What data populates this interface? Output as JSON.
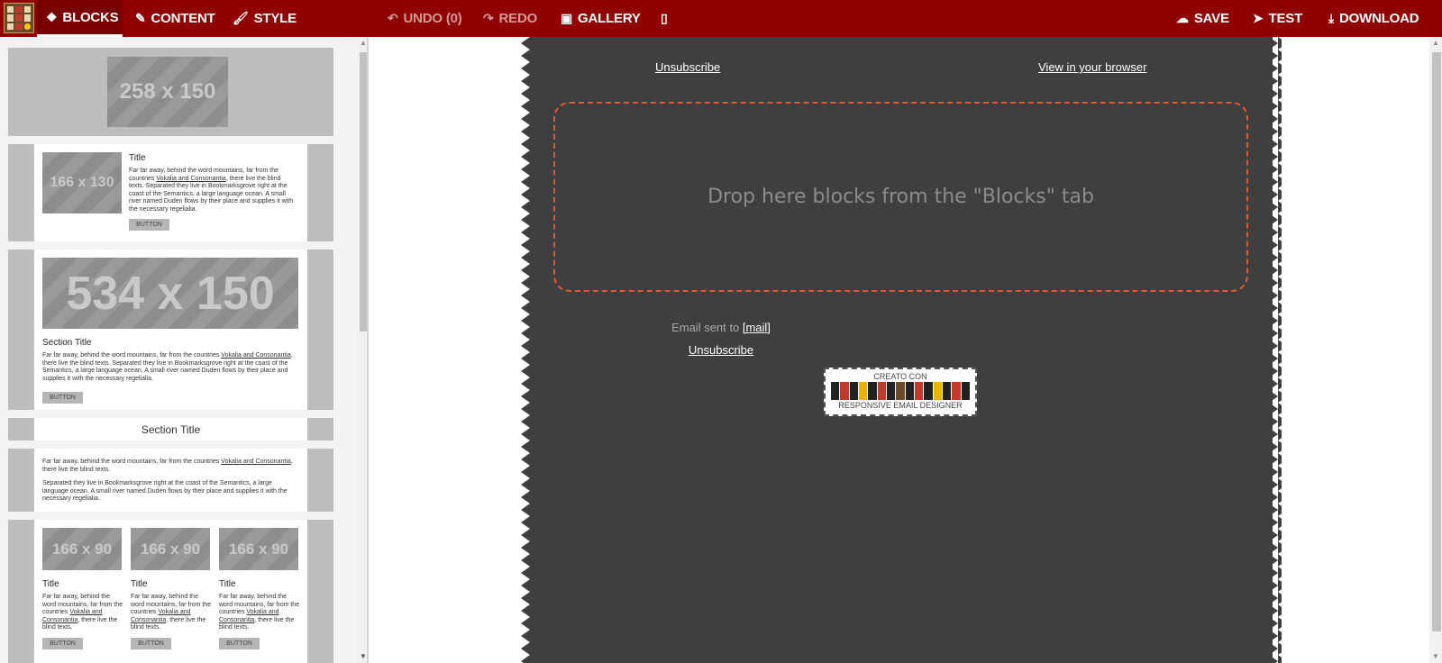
{
  "toolbar": {
    "tabs": [
      {
        "label": "BLOCKS",
        "icon": "cubes-icon"
      },
      {
        "label": "CONTENT",
        "icon": "pencil-icon"
      },
      {
        "label": "STYLE",
        "icon": "brush-icon"
      }
    ],
    "undo_label": "UNDO (0)",
    "redo_label": "REDO",
    "gallery_label": "GALLERY",
    "save_label": "SAVE",
    "test_label": "TEST",
    "download_label": "DOWNLOAD"
  },
  "blocks": {
    "b1": {
      "placeholder": "258 x 150"
    },
    "b2": {
      "placeholder": "166 x 130",
      "title": "Title",
      "text_pre": "Far far away, behind the word mountains, far from the countries ",
      "link": "Vokalia and Consonantia",
      "text_post": ", there live the blind texts. Separated they live in Bookmarksgrove right at the coast of the Semantics, a large language ocean. A small river named Duden flows by their place and supplies it with the necessary regelialia.",
      "button": "BUTTON"
    },
    "b3": {
      "placeholder": "534 x 150",
      "title": "Section Title",
      "text_pre": "Far far away, behind the word mountains, far from the countries ",
      "link": "Vokalia and Consonantia",
      "text_post": ", there live the blind texts. Separated they live in Bookmarksgrove right at the coast of the Semantics, a large language ocean. A small river named Duden flows by their place and supplies it with the necessary regelialia.",
      "button": "BUTTON"
    },
    "b4": {
      "title": "Section Title"
    },
    "b5": {
      "p1_pre": "Far far away, behind the word mountains, far from the countries ",
      "link": "Vokalia and Consonantia",
      "p1_post": ", there live the blind texts.",
      "p2": "Separated they live in Bookmarksgrove right at the coast of the Semantics, a large language ocean. A small river named Duden flows by their place and supplies it with the necessary regelialia."
    },
    "b6": {
      "columns": [
        {
          "placeholder": "166 x 90",
          "title": "Title",
          "text_pre": "Far far away, behind the word mountains, far from the countries ",
          "link": "Vokalia and Consonantia",
          "text_post": ", there live the blind texts.",
          "button": "BUTTON"
        },
        {
          "placeholder": "166 x 90",
          "title": "Title",
          "text_pre": "Far far away, behind the word mountains, far from the countries ",
          "link": "Vokalia and Consonantia",
          "text_post": ", there live the blind texts.",
          "button": "BUTTON"
        },
        {
          "placeholder": "166 x 90",
          "title": "Title",
          "text_pre": "Far far away, behind the word mountains, far from the countries ",
          "link": "Vokalia and Consonantia",
          "text_post": ", there live the blind texts.",
          "button": "BUTTON"
        }
      ]
    }
  },
  "email": {
    "unsubscribe_top": "Unsubscribe",
    "view_browser": "View in your browser",
    "drop_text": "Drop here blocks from the \"Blocks\" tab",
    "sent_to": "Email sent to ",
    "mail_tag": "[mail]",
    "unsubscribe_bottom": "Unsubscribe",
    "badge_top": "CREATO CON",
    "badge_bottom": "RESPONSIVE EMAIL DESIGNER"
  },
  "colors": {
    "topbar": "#900000",
    "email_bg": "#3f3f3f",
    "drop_border": "#e4572e"
  }
}
